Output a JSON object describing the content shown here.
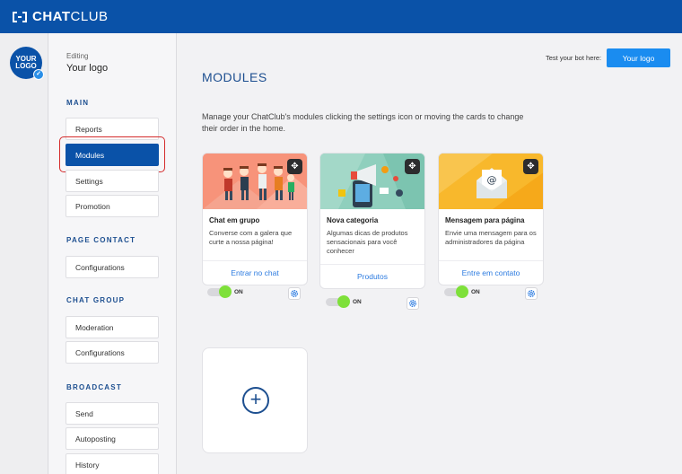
{
  "app": {
    "brand_bold": "CHAT",
    "brand_light": "CLUB"
  },
  "avatar": {
    "text_line1": "YOUR",
    "text_line2": "LOGO"
  },
  "sidebar": {
    "editing_label": "Editing",
    "editing_title": "Your logo",
    "sections": [
      {
        "title": "MAIN",
        "items": [
          "Reports",
          "Modules",
          "Settings",
          "Promotion"
        ]
      },
      {
        "title": "PAGE CONTACT",
        "items": [
          "Configurations"
        ]
      },
      {
        "title": "CHAT GROUP",
        "items": [
          "Moderation",
          "Configurations"
        ]
      },
      {
        "title": "BROADCAST",
        "items": [
          "Send",
          "Autoposting",
          "History"
        ]
      }
    ],
    "active_item": "Modules"
  },
  "header": {
    "test_label": "Test your bot here:",
    "logo_button": "Your logo"
  },
  "main": {
    "title": "MODULES",
    "intro": "Manage your ChatClub's modules clicking the settings icon or moving the cards to change their order in the home."
  },
  "cards": [
    {
      "title": "Chat em grupo",
      "description": "Converse com a galera que curte a nossa página!",
      "link": "Entrar no chat",
      "toggle": "ON",
      "image_color": "#f7937a"
    },
    {
      "title": "Nova categoria",
      "description": "Algumas dicas de produtos sensacionais para você conhecer",
      "link": "Produtos",
      "toggle": "ON",
      "image_color": "#8fcfbd"
    },
    {
      "title": "Mensagem para página",
      "description": "Envie uma mensagem para os administradores da página",
      "link": "Entre em contato",
      "toggle": "ON",
      "image_color": "#f8b82c"
    }
  ],
  "add_card": {
    "icon": "plus-icon"
  },
  "colors": {
    "brand": "#0a52a8",
    "accent": "#1a8cf0",
    "toggle_on": "#7ee03a"
  }
}
